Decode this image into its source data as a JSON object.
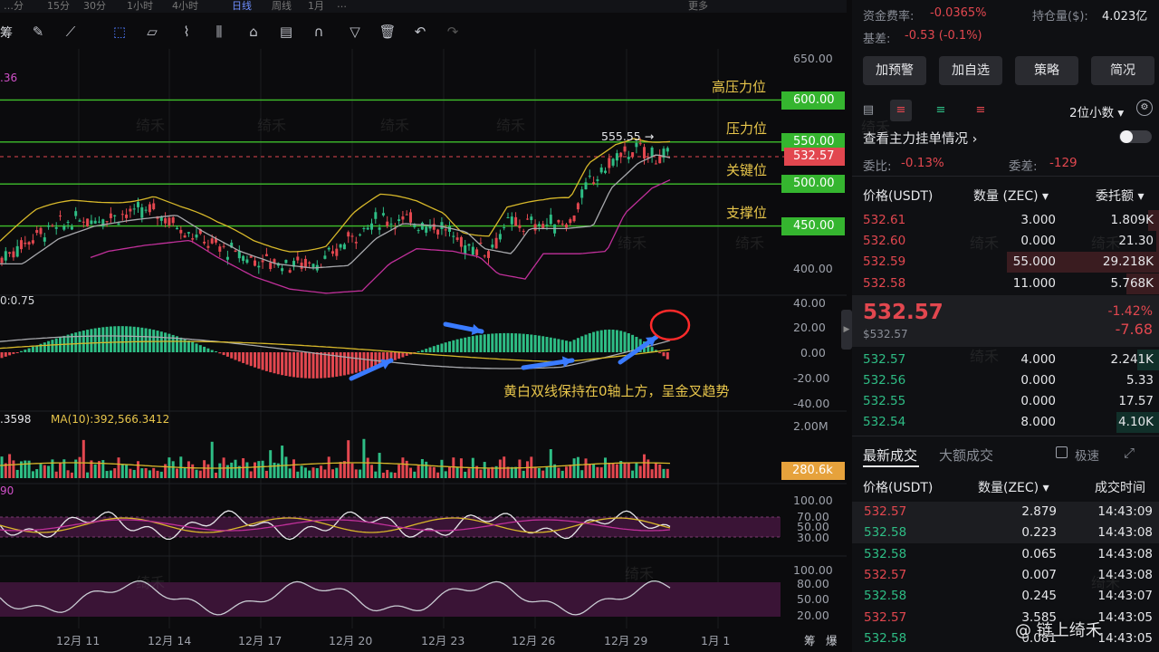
{
  "top_tabs": [
    "…分",
    "15分",
    "30分",
    "1小时",
    "4小时",
    "日线",
    "周线",
    "1月",
    "…",
    "更多"
  ],
  "toolbar": {
    "label": "筹",
    "tools": [
      "draw-icon",
      "trend-line-icon",
      "select-icon",
      "ruler-icon",
      "brush-icon",
      "ohlc-icon",
      "lock-icon",
      "note-icon",
      "magnet-icon",
      "filter-icon",
      "trash-icon",
      "undo-icon",
      "redo-icon"
    ]
  },
  "price_axis": [
    "650.00",
    "400.00"
  ],
  "indicator_labels": {
    "boll_value": ".36",
    "macd_value": "0:0.75",
    "vol_value": ".3598",
    "vol_ma": "MA(10):392,566.3412",
    "rsi_value": "90",
    "macd_axis": [
      "40.00",
      "20.00",
      "0.00",
      "-20.00",
      "-40.00"
    ],
    "vol_axis": "2.00M",
    "vol_tag": "280.6k",
    "rsi_axis": [
      "100.00",
      "70.00",
      "50.00",
      "30.00"
    ],
    "kdj_axis": [
      "100.00",
      "80.00",
      "50.00",
      "20.00"
    ]
  },
  "levels": [
    {
      "label": "高压力位",
      "price": "600.00"
    },
    {
      "label": "压力位",
      "price": "550.00"
    },
    {
      "label": "关键位",
      "price": "500.00"
    },
    {
      "label": "支撑位",
      "price": "450.00"
    }
  ],
  "current_price_tag": "532.57",
  "high_marker": "555.55",
  "macd_note": "黄白双线保持在0轴上方，呈金叉趋势",
  "dates": [
    "12月 11",
    "12月 14",
    "12月 17",
    "12月 20",
    "12月 23",
    "12月 26",
    "12月 29",
    "1月 1"
  ],
  "bottom_right_icons": [
    "筹",
    "爆"
  ],
  "watermark": "绮禾",
  "right": {
    "funding_label": "资金费率:",
    "funding_value": "-0.0365%",
    "oi_label": "持仓量($):",
    "oi_value": "4.023亿",
    "basis_label": "基差:",
    "basis_value": "-0.53 (-0.1%)",
    "buttons": [
      "加预警",
      "加自选",
      "策略",
      "简况"
    ],
    "decimals": "2位小数",
    "main_orders_label": "查看主力挂单情况",
    "ratio_label": "委比:",
    "ratio_value": "-0.13%",
    "diff_label": "委差:",
    "diff_value": "-129",
    "ob_headers": {
      "price": "价格(USDT)",
      "qty": "数量 (ZEC)",
      "total": "委托额"
    },
    "asks": [
      {
        "price": "532.61",
        "qty": "3.000",
        "total": "1.809K"
      },
      {
        "price": "532.60",
        "qty": "0.000",
        "total": "21.30"
      },
      {
        "price": "532.59",
        "qty": "55.000",
        "total": "29.218K"
      },
      {
        "price": "532.58",
        "qty": "11.000",
        "total": "5.768K"
      }
    ],
    "last_price": "532.57",
    "last_price_sub": "$532.57",
    "change_pct": "-1.42%",
    "change_abs": "-7.68",
    "bids": [
      {
        "price": "532.57",
        "qty": "4.000",
        "total": "2.241K"
      },
      {
        "price": "532.56",
        "qty": "0.000",
        "total": "5.33"
      },
      {
        "price": "532.55",
        "qty": "0.000",
        "total": "17.57"
      },
      {
        "price": "532.54",
        "qty": "8.000",
        "total": "4.10K"
      }
    ],
    "trade_tabs": [
      "最新成交",
      "大额成交"
    ],
    "speed_label": "极速",
    "trade_headers": {
      "price": "价格(USDT)",
      "qty": "数量(ZEC)",
      "time": "成交时间"
    },
    "trades": [
      {
        "price": "532.57",
        "qty": "2.879",
        "time": "14:43:09",
        "side": "sell"
      },
      {
        "price": "532.58",
        "qty": "0.223",
        "time": "14:43:08",
        "side": "buy"
      },
      {
        "price": "532.58",
        "qty": "0.065",
        "time": "14:43:08",
        "side": "buy"
      },
      {
        "price": "532.57",
        "qty": "0.007",
        "time": "14:43:08",
        "side": "sell"
      },
      {
        "price": "532.58",
        "qty": "0.245",
        "time": "14:43:07",
        "side": "buy"
      },
      {
        "price": "532.57",
        "qty": "3.585",
        "time": "14:43:05",
        "side": "sell"
      },
      {
        "price": "532.58",
        "qty": "0.081",
        "time": "14:43:05",
        "side": "buy"
      }
    ],
    "brand": "@ 链上绮禾"
  }
}
